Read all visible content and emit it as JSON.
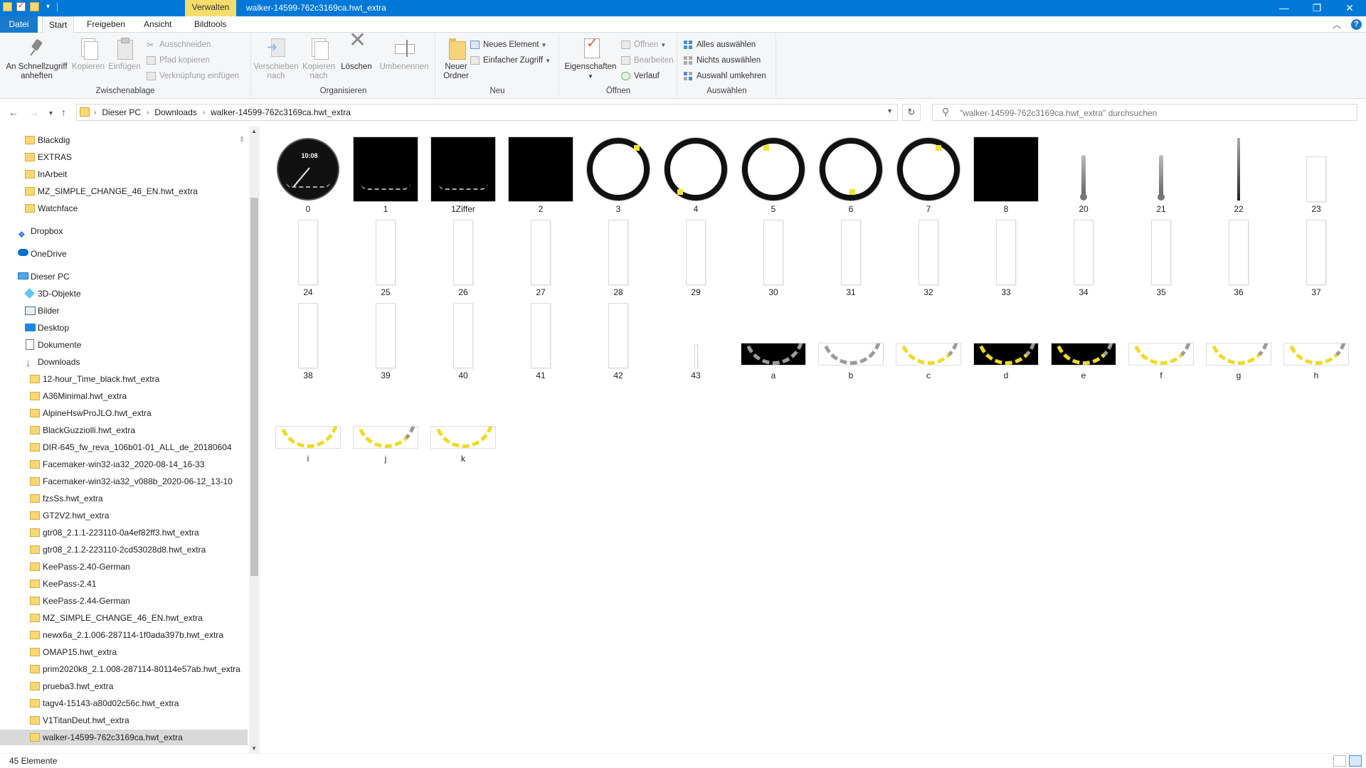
{
  "window": {
    "title": "walker-14599-762c3169ca.hwt_extra",
    "context_tab": "Verwalten"
  },
  "ribbon_tabs": [
    "Datei",
    "Start",
    "Freigeben",
    "Ansicht",
    "Bildtools"
  ],
  "ribbon": {
    "clipboard": {
      "label": "Zwischenablage",
      "pin": "An Schnellzugriff anheften",
      "copy": "Kopieren",
      "paste": "Einfügen",
      "cut": "Ausschneiden",
      "copy_path": "Pfad kopieren",
      "paste_link": "Verknüpfung einfügen"
    },
    "organize": {
      "label": "Organisieren",
      "move": "Verschieben nach",
      "copy_to": "Kopieren nach",
      "delete": "Löschen",
      "rename": "Umbenennen"
    },
    "new": {
      "label": "Neu",
      "new_folder": "Neuer Ordner",
      "new_item": "Neues Element",
      "easy_access": "Einfacher Zugriff"
    },
    "open": {
      "label": "Öffnen",
      "properties": "Eigenschaften",
      "open": "Öffnen",
      "edit": "Bearbeiten",
      "history": "Verlauf"
    },
    "select": {
      "label": "Auswählen",
      "select_all": "Alles auswählen",
      "select_none": "Nichts auswählen",
      "invert": "Auswahl umkehren"
    }
  },
  "address": {
    "crumbs": [
      "Dieser PC",
      "Downloads",
      "walker-14599-762c3169ca.hwt_extra"
    ],
    "search_placeholder": "\"walker-14599-762c3169ca.hwt_extra\" durchsuchen"
  },
  "nav": {
    "quick": [
      "Blackdig",
      "EXTRAS",
      "InArbeit",
      "MZ_SIMPLE_CHANGE_46_EN.hwt_extra",
      "Watchface"
    ],
    "dropbox": "Dropbox",
    "onedrive": "OneDrive",
    "thispc": "Dieser PC",
    "pc_items": [
      "3D-Objekte",
      "Bilder",
      "Desktop",
      "Dokumente",
      "Downloads"
    ],
    "downloads": [
      "12-hour_Time_black.hwt_extra",
      "A36Minimal.hwt_extra",
      "AlpineHswProJLO.hwt_extra",
      "BlackGuzziolli.hwt_extra",
      "DIR-645_fw_reva_106b01-01_ALL_de_20180604",
      "Facemaker-win32-ia32_2020-08-14_16-33",
      "Facemaker-win32-ia32_v088b_2020-06-12_13-10",
      "fzsSs.hwt_extra",
      "GT2V2.hwt_extra",
      "gtr08_2.1.1-223110-0a4ef82ff3.hwt_extra",
      "gtr08_2.1.2-223110-2cd53028d8.hwt_extra",
      "KeePass-2.40-German",
      "KeePass-2.41",
      "KeePass-2.44-German",
      "MZ_SIMPLE_CHANGE_46_EN.hwt_extra",
      "newx6a_2.1.006-287114-1f0ada397b.hwt_extra",
      "OMAP15.hwt_extra",
      "prim2020k8_2.1.008-287114-80114e57ab.hwt_extra",
      "prueba3.hwt_extra",
      "tagv4-15143-a80d02c56c.hwt_extra",
      "V1TitanDeut.hwt_extra",
      "walker-14599-762c3169ca.hwt_extra"
    ],
    "selected": "walker-14599-762c3169ca.hwt_extra"
  },
  "files": [
    {
      "name": "0",
      "kind": "watch"
    },
    {
      "name": "1",
      "kind": "dialtick"
    },
    {
      "name": "1Ziffer",
      "kind": "dialplain"
    },
    {
      "name": "2",
      "kind": "dialdark"
    },
    {
      "name": "3",
      "kind": "ring"
    },
    {
      "name": "4",
      "kind": "ring"
    },
    {
      "name": "5",
      "kind": "ring"
    },
    {
      "name": "6",
      "kind": "ring"
    },
    {
      "name": "7",
      "kind": "ring"
    },
    {
      "name": "8",
      "kind": "dialdark"
    },
    {
      "name": "20",
      "kind": "gauge"
    },
    {
      "name": "21",
      "kind": "gauge"
    },
    {
      "name": "22",
      "kind": "needle"
    },
    {
      "name": "23",
      "kind": "paper"
    },
    {
      "name": "24",
      "kind": "paper"
    },
    {
      "name": "25",
      "kind": "paper"
    },
    {
      "name": "26",
      "kind": "paper"
    },
    {
      "name": "27",
      "kind": "paper"
    },
    {
      "name": "28",
      "kind": "paper"
    },
    {
      "name": "29",
      "kind": "paper"
    },
    {
      "name": "30",
      "kind": "paper"
    },
    {
      "name": "31",
      "kind": "paper"
    },
    {
      "name": "32",
      "kind": "paper"
    },
    {
      "name": "33",
      "kind": "paper"
    },
    {
      "name": "34",
      "kind": "paper"
    },
    {
      "name": "35",
      "kind": "paper"
    },
    {
      "name": "36",
      "kind": "paper"
    },
    {
      "name": "37",
      "kind": "paper"
    },
    {
      "name": "38",
      "kind": "paper"
    },
    {
      "name": "39",
      "kind": "paper"
    },
    {
      "name": "40",
      "kind": "paper"
    },
    {
      "name": "41",
      "kind": "paper"
    },
    {
      "name": "42",
      "kind": "paper"
    },
    {
      "name": "43",
      "kind": "thin"
    },
    {
      "name": "a",
      "kind": "arc-black-grey"
    },
    {
      "name": "b",
      "kind": "arc-grey"
    },
    {
      "name": "c",
      "kind": "arc-mix"
    },
    {
      "name": "d",
      "kind": "arc-black-mix"
    },
    {
      "name": "e",
      "kind": "arc-black-mix"
    },
    {
      "name": "f",
      "kind": "arc-mix"
    },
    {
      "name": "g",
      "kind": "arc-mix"
    },
    {
      "name": "h",
      "kind": "arc-mix"
    },
    {
      "name": "i",
      "kind": "arc-yellow"
    },
    {
      "name": "j",
      "kind": "arc-mix"
    },
    {
      "name": "k",
      "kind": "arc-yellow"
    }
  ],
  "status": {
    "count": "45 Elemente"
  },
  "colors": {
    "titlebar": "#0078d7",
    "manage_tab": "#f5dd6c",
    "accent_yellow": "#f0da29"
  }
}
